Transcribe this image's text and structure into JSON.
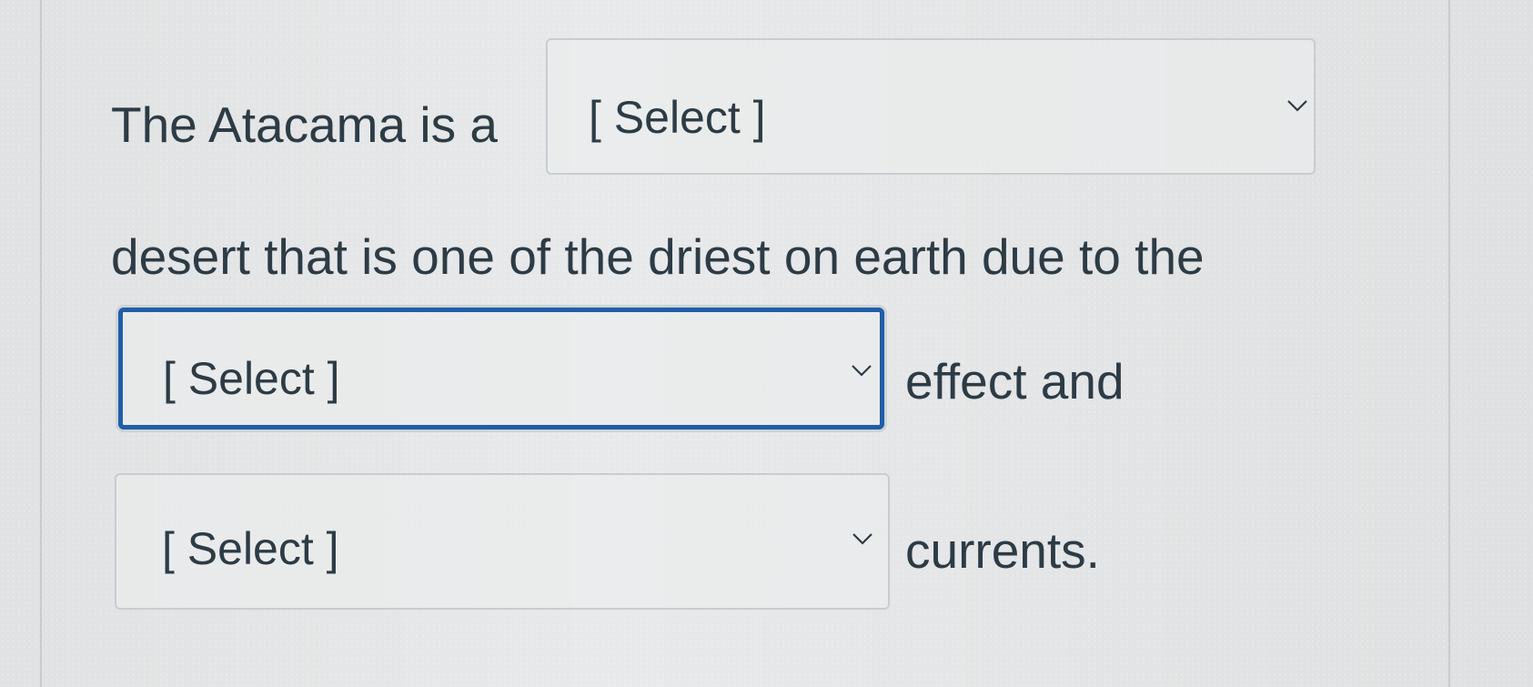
{
  "question": {
    "part1": "The Atacama is a",
    "part2": "desert that is one of the driest on earth due to the",
    "part3": "effect and",
    "part4": "currents."
  },
  "dropdowns": [
    {
      "selected": "[ Select ]",
      "focused": false
    },
    {
      "selected": "[ Select ]",
      "focused": true
    },
    {
      "selected": "[ Select ]",
      "focused": false
    }
  ],
  "icons": {
    "dropdown_arrow": "chevron-down-icon"
  },
  "colors": {
    "focus_border": "#1f5ea8",
    "text": "#2d3b45",
    "border": "#c7cdd1"
  }
}
